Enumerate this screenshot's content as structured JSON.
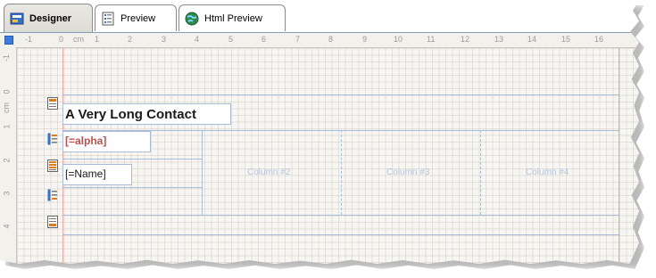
{
  "tabs": [
    {
      "label": "Designer",
      "icon": "designer-icon",
      "active": true
    },
    {
      "label": "Preview",
      "icon": "preview-icon",
      "active": false
    },
    {
      "label": "Html Preview",
      "icon": "globe-icon",
      "active": false
    }
  ],
  "ruler": {
    "unit": "cm",
    "h_ticks": [
      "-1",
      "0",
      "cm",
      "1",
      "2",
      "3",
      "4",
      "5",
      "6",
      "7",
      "8",
      "9",
      "10",
      "11",
      "12",
      "13",
      "14",
      "15",
      "16"
    ],
    "v_ticks": [
      "-1",
      "0",
      "cm",
      "1",
      "2",
      "3",
      "4"
    ]
  },
  "report": {
    "title_text": "A Very Long Contact",
    "alpha_field": "[=alpha]",
    "name_field": "[=Name]",
    "columns": [
      "Column #2",
      "Column #3",
      "Column #4"
    ]
  },
  "colors": {
    "alpha_text": "#c0504d",
    "guide_lines": "#a8bcd8",
    "margin_line": "#e8a8a8"
  }
}
